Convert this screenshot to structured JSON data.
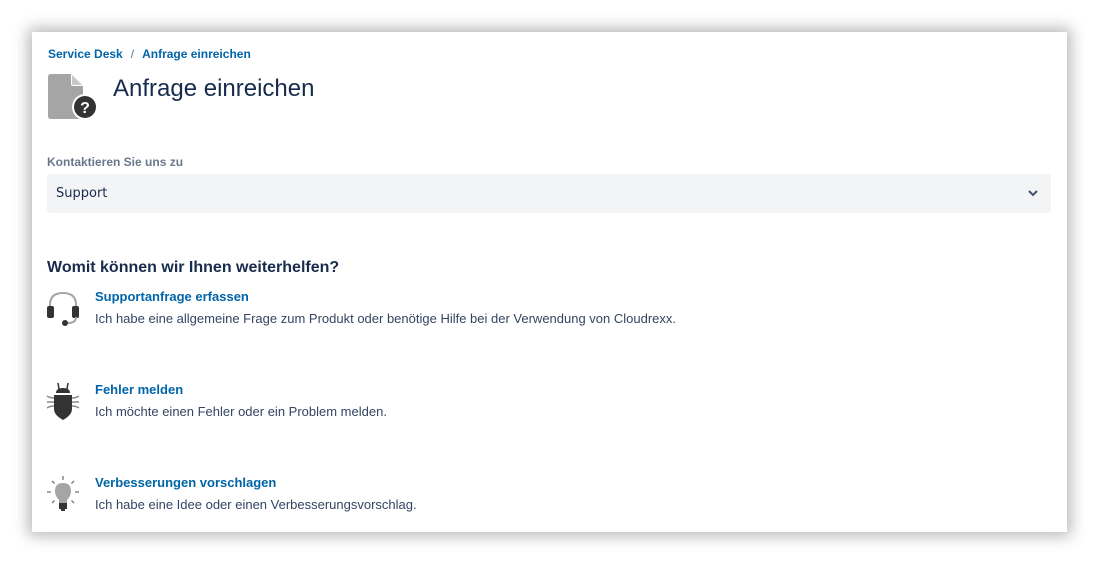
{
  "breadcrumb": {
    "items": [
      "Service Desk",
      "Anfrage einreichen"
    ],
    "separator": "/"
  },
  "header": {
    "title": "Anfrage einreichen",
    "icon": "document-question-icon"
  },
  "contact_field": {
    "label": "Kontaktieren Sie uns zu",
    "selected": "Support",
    "icon": "chevron-down-icon"
  },
  "section": {
    "title": "Womit können wir Ihnen weiterhelfen?"
  },
  "options": [
    {
      "icon": "headset-icon",
      "title": "Supportanfrage erfassen",
      "description": "Ich habe eine allgemeine Frage zum Produkt oder benötige Hilfe bei der Verwendung von Cloudrexx."
    },
    {
      "icon": "bug-icon",
      "title": "Fehler melden",
      "description": "Ich möchte einen Fehler oder ein Problem melden."
    },
    {
      "icon": "lightbulb-icon",
      "title": "Verbesserungen vorschlagen",
      "description": "Ich habe eine Idee oder einen Verbesserungsvorschlag."
    }
  ],
  "colors": {
    "link": "#0065a8",
    "heading": "#172b4d",
    "label": "#6b778c",
    "select_bg": "#f3f4f6",
    "icon_gray": "#a5a5a5",
    "icon_dark": "#333333"
  }
}
